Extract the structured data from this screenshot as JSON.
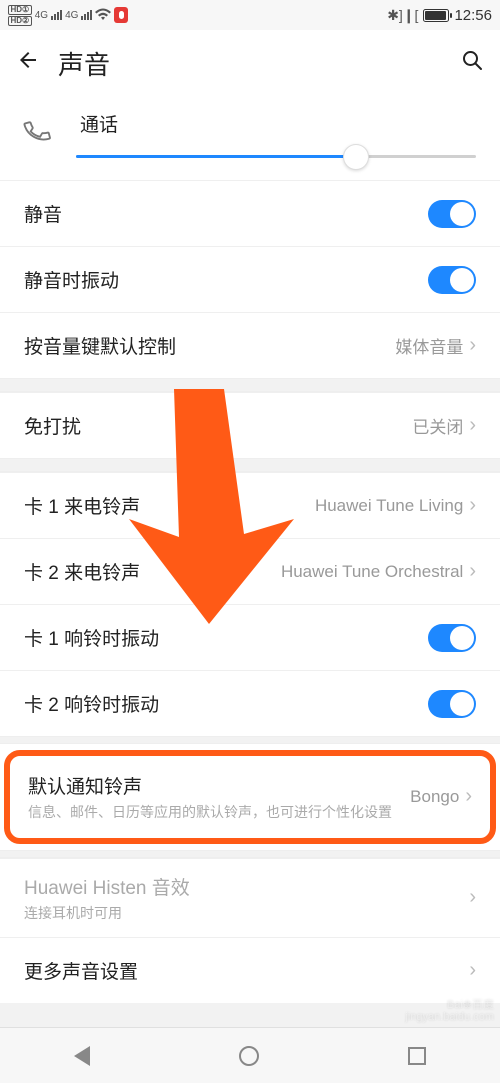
{
  "status": {
    "hd1": "HD①",
    "hd2": "HD②",
    "net": "4G",
    "bt_vibrate": "✱▯❙",
    "time": "12:56"
  },
  "header": {
    "title": "声音"
  },
  "slider": {
    "label": "通话"
  },
  "rows": {
    "silent": "静音",
    "vibrate_on_silent": "静音时振动",
    "volume_key_default": {
      "label": "按音量键默认控制",
      "value": "媒体音量"
    },
    "dnd": {
      "label": "免打扰",
      "value": "已关闭"
    },
    "sim1_ringtone": {
      "label": "卡 1 来电铃声",
      "value": "Huawei Tune Living"
    },
    "sim2_ringtone": {
      "label": "卡 2 来电铃声",
      "value": "Huawei Tune Orchestral"
    },
    "sim1_vibrate": "卡 1 响铃时振动",
    "sim2_vibrate": "卡 2 响铃时振动",
    "default_notif": {
      "label": "默认通知铃声",
      "sub": "信息、邮件、日历等应用的默认铃声，也可进行个性化设置",
      "value": "Bongo"
    },
    "histen": {
      "label": "Huawei Histen 音效",
      "sub": "连接耳机时可用"
    },
    "more": "更多声音设置"
  },
  "watermark": {
    "line1": "Bai❀百度",
    "line2": "jingyan.baidu.com"
  }
}
